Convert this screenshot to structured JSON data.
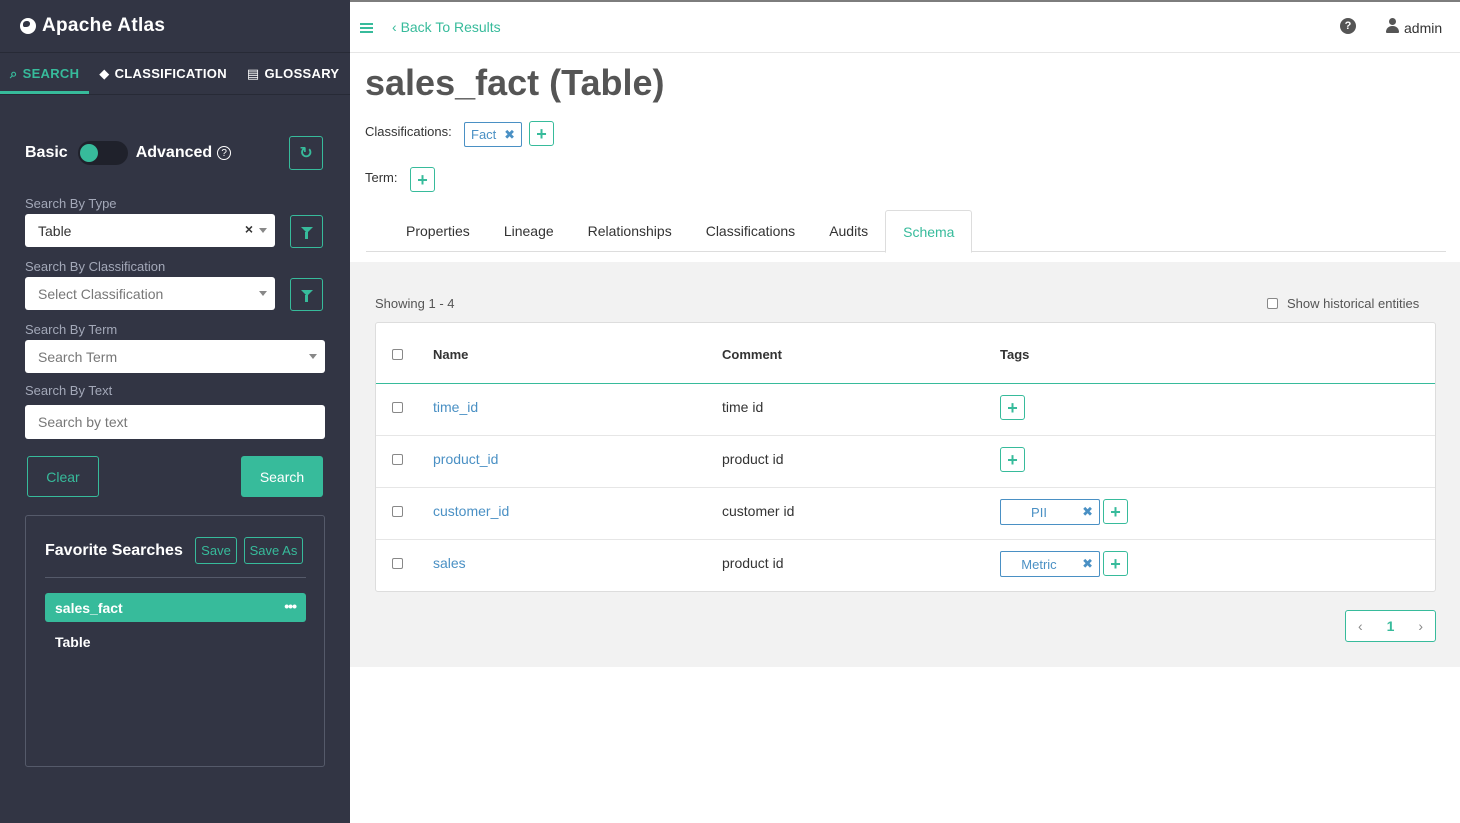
{
  "sidebar": {
    "brand": "Apache Atlas",
    "tabs": [
      {
        "label": "SEARCH",
        "icon": "search-icon"
      },
      {
        "label": "CLASSIFICATION",
        "icon": "tag-icon"
      },
      {
        "label": "GLOSSARY",
        "icon": "folder-icon"
      }
    ],
    "toggle": {
      "left": "Basic",
      "right": "Advanced"
    },
    "search_by_type": {
      "label": "Search By Type",
      "value": "Table"
    },
    "search_by_classification": {
      "label": "Search By Classification",
      "placeholder": "Select Classification"
    },
    "search_by_term": {
      "label": "Search By Term",
      "placeholder": "Search Term"
    },
    "search_by_text": {
      "label": "Search By Text",
      "placeholder": "Search by text"
    },
    "clear_label": "Clear",
    "search_label": "Search",
    "favorites": {
      "title": "Favorite Searches",
      "save_label": "Save",
      "save_as_label": "Save As",
      "active_item": "sales_fact",
      "more": "•••",
      "items": [
        "Table"
      ]
    }
  },
  "topbar": {
    "back_label": "Back To Results",
    "help": "?",
    "user": "admin"
  },
  "entity": {
    "title": "sales_fact (Table)",
    "classifications_label": "Classifications:",
    "classification_chip": "Fact",
    "term_label": "Term:"
  },
  "tabs": [
    "Properties",
    "Lineage",
    "Relationships",
    "Classifications",
    "Audits",
    "Schema"
  ],
  "schema": {
    "showing": "Showing 1 - 4",
    "historical_label": "Show historical entities",
    "columns": [
      "Name",
      "Comment",
      "Tags"
    ],
    "rows": [
      {
        "name": "time_id",
        "comment": "time id",
        "tag": ""
      },
      {
        "name": "product_id",
        "comment": "product id",
        "tag": ""
      },
      {
        "name": "customer_id",
        "comment": "customer id",
        "tag": "PII"
      },
      {
        "name": "sales",
        "comment": "product id",
        "tag": "Metric"
      }
    ],
    "page": "1"
  },
  "colors": {
    "accent": "#37bb9b",
    "sidebar_bg": "#323544",
    "tag_blue": "#4a90c4"
  }
}
